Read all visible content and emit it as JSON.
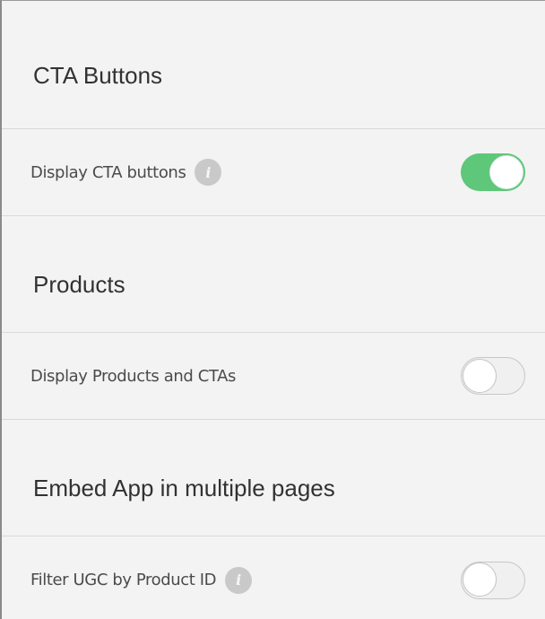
{
  "sections": [
    {
      "title": "CTA Buttons",
      "setting": {
        "label": "Display CTA buttons",
        "info_icon": "info-icon",
        "enabled": true
      }
    },
    {
      "title": "Products",
      "setting": {
        "label": "Display Products and CTAs",
        "enabled": false
      }
    },
    {
      "title": "Embed App in multiple pages",
      "setting": {
        "label": "Filter UGC by Product ID",
        "info_icon": "info-icon",
        "enabled": false
      }
    }
  ],
  "colors": {
    "toggle_on": "#5ec77a",
    "toggle_off": "#f0f0f0",
    "info_icon": "#c9c9c9"
  }
}
